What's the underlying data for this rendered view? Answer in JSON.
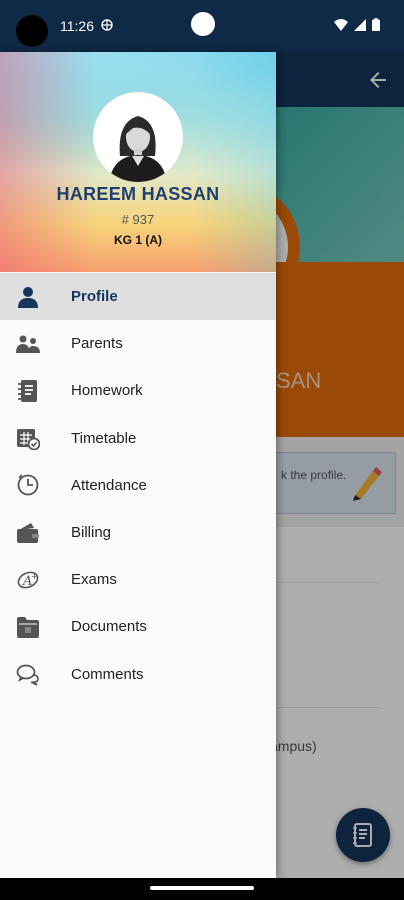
{
  "status_bar": {
    "time": "11:26",
    "icons": [
      "vpn-icon",
      "wifi-icon",
      "signal-icon",
      "battery-icon"
    ]
  },
  "background": {
    "name_fragment": "SAN",
    "card_text": "k the profile.",
    "campus_fragment": "ampus)"
  },
  "drawer": {
    "student_name": "HAREEM HASSAN",
    "student_id": "# 937",
    "student_class": "KG 1 (A)",
    "menu": [
      {
        "label": "Profile",
        "icon": "person-icon",
        "active": true
      },
      {
        "label": "Parents",
        "icon": "parents-icon",
        "active": false
      },
      {
        "label": "Homework",
        "icon": "notebook-icon",
        "active": false
      },
      {
        "label": "Timetable",
        "icon": "timetable-icon",
        "active": false
      },
      {
        "label": "Attendance",
        "icon": "clock-icon",
        "active": false
      },
      {
        "label": "Billing",
        "icon": "wallet-icon",
        "active": false
      },
      {
        "label": "Exams",
        "icon": "exam-icon",
        "active": false
      },
      {
        "label": "Documents",
        "icon": "documents-icon",
        "active": false
      },
      {
        "label": "Comments",
        "icon": "comments-icon",
        "active": false
      }
    ]
  },
  "colors": {
    "primary": "#15355c",
    "accent_orange": "#e46c0a",
    "name_color": "#1f3f73"
  }
}
